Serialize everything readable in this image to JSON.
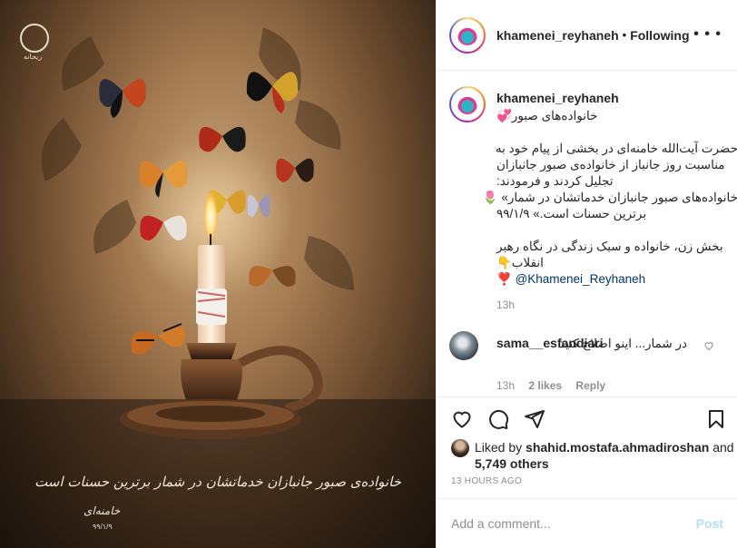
{
  "header": {
    "username": "khamenei_reyhaneh",
    "separator": "•",
    "follow_state": "Following",
    "more_icon": "more-horizontal-icon"
  },
  "image": {
    "logo_text": "ریحانه",
    "calligraphy": "خانواده‌ی صبور جانبازان خدماتشان در شمار برترین حسنات است",
    "signature": "خامنه‌ای",
    "signature_date": "۹۹/۱/۹"
  },
  "caption": {
    "username": "khamenei_reyhaneh",
    "lines": [
      "خانواده‌های صبور💞",
      "",
      "حضرت آیت‌الله خامنه‌ای در بخشی از پیام خود به",
      "مناسبت روز جانباز از خانواده‌ی صبور جانبازان",
      "تجلیل کردند و فرمودند:",
      "خانواده‌های صبور جانبازان خدماتشان در شمار» 🌷",
      "برترین حسنات است.» ۹۹/۱/۹",
      "",
      "بخش زن، خانواده و سبک زندگی در نگاه رهبر",
      "انقلاب👇"
    ],
    "mention_prefix": "❣️ ",
    "mention": "@Khamenei_Reyhaneh",
    "time": "13h"
  },
  "comment": {
    "username": "sama__esfandiari",
    "text": "در شمار... اینو اصلاح کنید",
    "time": "13h",
    "likes": "2 likes",
    "reply": "Reply"
  },
  "actions": {
    "liked_by_prefix": "Liked by ",
    "liked_by_user": "shahid.mostafa.ahmadiroshan",
    "liked_by_and": " and",
    "others": "5,749 others",
    "ago": "13 HOURS AGO"
  },
  "add_comment": {
    "placeholder": "Add a comment...",
    "post_label": "Post"
  },
  "colors": {
    "link": "#00376b",
    "muted": "#8e8e8e",
    "post_disabled": "#b2dffc"
  }
}
